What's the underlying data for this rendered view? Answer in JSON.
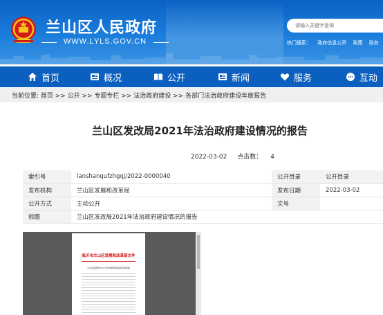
{
  "header": {
    "site_title": "兰山区人民政府",
    "site_url": "WWW.LYLS.GOV.CN",
    "search_placeholder": "请输入关键字查询",
    "hot_label": "热门搜索：",
    "hot_items": [
      "政府信息公开",
      "政策",
      "政务"
    ]
  },
  "nav": {
    "items": [
      {
        "label": "首页",
        "icon": "home-icon"
      },
      {
        "label": "概况",
        "icon": "overview-icon"
      },
      {
        "label": "公开",
        "icon": "book-icon"
      },
      {
        "label": "新闻",
        "icon": "news-icon"
      },
      {
        "label": "服务",
        "icon": "heart-icon"
      },
      {
        "label": "互动",
        "icon": "chat-icon"
      }
    ]
  },
  "breadcrumb": {
    "text": "当前位置: 首页 >> 公开 >> 专题专栏 >> 法治政府建设 >> 各部门法治政府建设年度报告"
  },
  "article": {
    "title": "兰山区发改局2021年法治政府建设情况的报告",
    "date": "2022-03-02",
    "views_label": "点击数：",
    "views": "4"
  },
  "info_table": {
    "rows": [
      [
        "索引号",
        "lanshanqufzhgqj/2022-0000040",
        "公开目录",
        "公开目录"
      ],
      [
        "发布机构",
        "兰山区发展和改革局",
        "发布日期",
        "2022-03-02"
      ],
      [
        "公开方式",
        "主动公开",
        "文号",
        ""
      ],
      [
        "标题",
        "兰山区发改局2021年法治政府建设情况的报告",
        "",
        ""
      ]
    ]
  },
  "document_preview": {
    "header_text": "临沂市兰山区发展和改革局文件",
    "subtitle": "兰山区发改局2021年法治政府建设情况的报告"
  }
}
